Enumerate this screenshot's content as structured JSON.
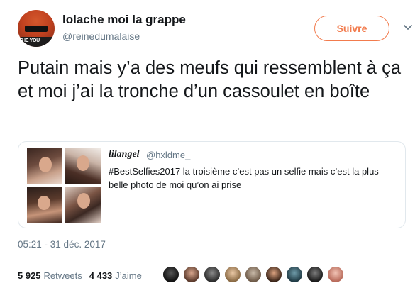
{
  "user": {
    "name": "lolache moi la grappe",
    "handle": "@reinedumalaise",
    "avatar_text": "THE YOU"
  },
  "follow_label": "Suivre",
  "tweet_text": "Putain mais y’a des meufs qui ressemblent à ça et moi j’ai la tronche d’un cassoulet en boîte",
  "quoted": {
    "name": "lilangel",
    "handle": "@hxldme_",
    "text": "#BestSelfies2017 la troisième c’est pas un selfie mais c’est la plus belle photo de moi qu’on ai prise"
  },
  "timestamp": "05:21 - 31 déc. 2017",
  "stats": {
    "retweets_count": "5 925",
    "retweets_label": "Retweets",
    "likes_count": "4 433",
    "likes_label": "J’aime"
  },
  "colors": {
    "accent": "#f27b4d",
    "secondary_text": "#657786",
    "border": "#e1e8ed"
  },
  "icons": {
    "caret": "chevron-down-icon"
  }
}
